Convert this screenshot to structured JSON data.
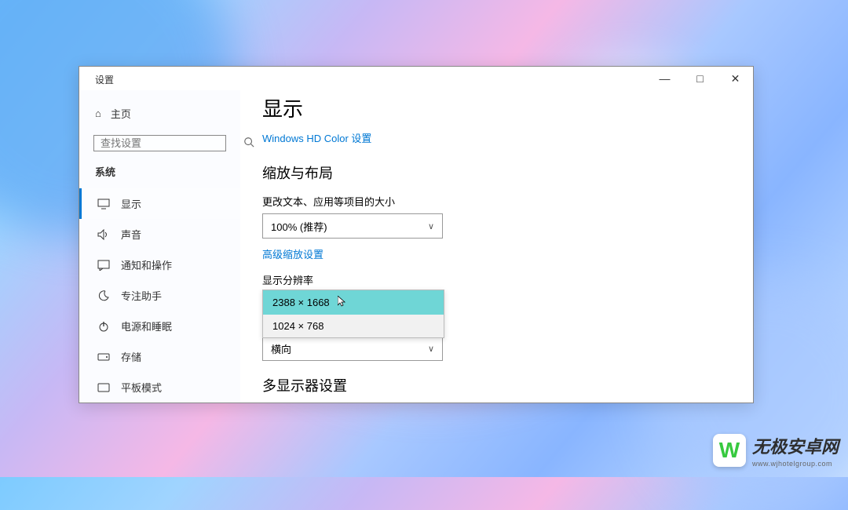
{
  "app_title": "设置",
  "titlebar": {
    "min": "—",
    "max": "□",
    "close": "✕"
  },
  "sidebar": {
    "home_label": "主页",
    "search_placeholder": "查找设置",
    "group_label": "系统",
    "items": [
      {
        "icon": "display-icon",
        "glyph": "🖵",
        "label": "显示"
      },
      {
        "icon": "sound-icon",
        "glyph": "🔊",
        "label": "声音"
      },
      {
        "icon": "notifications-icon",
        "glyph": "💬",
        "label": "通知和操作"
      },
      {
        "icon": "focus-assist-icon",
        "glyph": "☽",
        "label": "专注助手"
      },
      {
        "icon": "power-sleep-icon",
        "glyph": "⏻",
        "label": "电源和睡眠"
      },
      {
        "icon": "storage-icon",
        "glyph": "▭",
        "label": "存储"
      },
      {
        "icon": "tablet-mode-icon",
        "glyph": "▭",
        "label": "平板模式"
      }
    ]
  },
  "content": {
    "page_title": "显示",
    "hd_color_link": "Windows HD Color 设置",
    "scale_section_title": "缩放与布局",
    "scale_field_label": "更改文本、应用等项目的大小",
    "scale_value": "100% (推荐)",
    "advanced_scale_link": "高级缩放设置",
    "resolution_field_label": "显示分辨率",
    "resolution_options": [
      "2388 × 1668",
      "1024 × 768"
    ],
    "resolution_highlight_index": 0,
    "orientation_value": "横向",
    "multi_monitor_title": "多显示器设置"
  },
  "watermark": {
    "brand": "无极安卓网",
    "url": "www.wjhotelgroup.com"
  }
}
